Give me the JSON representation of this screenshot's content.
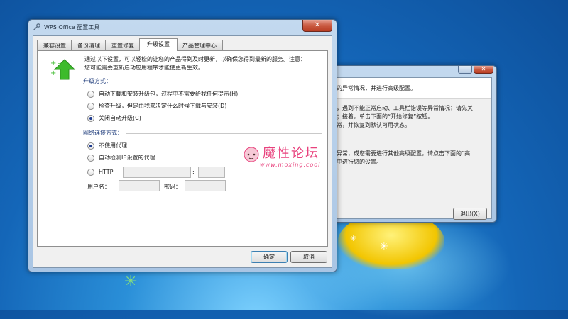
{
  "background_window": {
    "lines": [
      "到的异常情况，并进行高级配置。",
      "时，遇到不能正常启动、工具栏错误等异常情况；请先关",
      "复；接着，单击下面的“开始修复”按钮。",
      "异常，并恢复到默认可用状态。",
      "复异常，或您需要进行其他高级配置，请点击下面的“高",
      "步中进行您的设置。"
    ],
    "exit_button": "退出(X)"
  },
  "main_window": {
    "title": "WPS Office 配置工具",
    "tabs": [
      "兼容设置",
      "备份清理",
      "重置修复",
      "升级设置",
      "产品管理中心"
    ],
    "active_tab": "升级设置",
    "intro": [
      "通过以下设置，可以轻松的让您的产品得到及时更新，以确保您得到最新的服务。注意：",
      "您可能需要重新启动应用程序才能使更新生效。"
    ],
    "upgrade": {
      "section_label": "升级方式：",
      "options": [
        {
          "label": "自动下载和安装升级包，过程中不需要给我任何提示(H)",
          "selected": false
        },
        {
          "label": "检查升级，但是由我来决定什么时候下载与安装(D)",
          "selected": false
        },
        {
          "label": "关闭自动升级(C)",
          "selected": true
        }
      ]
    },
    "network": {
      "section_label": "网络连接方式：",
      "options": [
        {
          "label": "不使用代理",
          "selected": true
        },
        {
          "label": "自动检测IE设置的代理",
          "selected": false
        },
        {
          "label": "HTTP",
          "selected": false
        }
      ],
      "host_value": "",
      "colon": ":",
      "port_value": "",
      "username_label": "用户名：",
      "username_value": "",
      "password_label": "密码：",
      "password_value": ""
    },
    "ok_button": "确定",
    "cancel_button": "取消"
  },
  "watermark": {
    "title": "魔性论坛",
    "url": "www.moxing.cool"
  },
  "colors": {
    "accent_green": "#3dbb2c",
    "selected_radio": "#1e3c90",
    "section_label": "#1c3a7a",
    "watermark_pink": "#e8427d"
  }
}
